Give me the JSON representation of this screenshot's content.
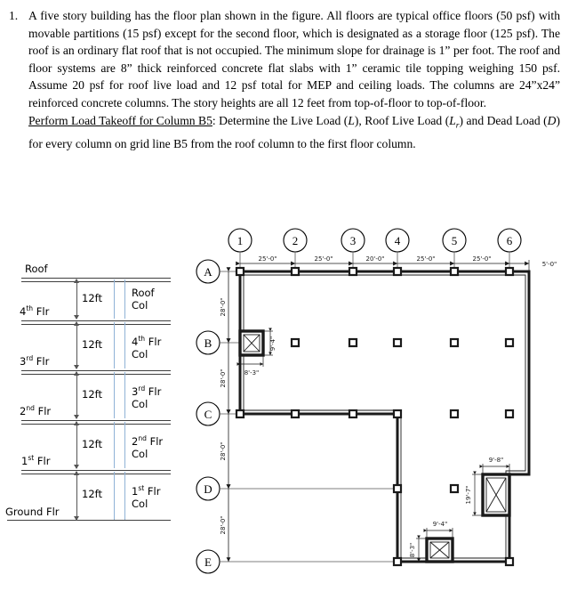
{
  "problem": {
    "number": "1.",
    "paragraphs": [
      "A five story building has the floor plan shown in the figure. All floors are typical office floors (50 psf) with movable partitions (15 psf) except for the second floor, which is designated as a storage floor (125 psf). The roof is an ordinary flat roof that is not occupied. The minimum slope for drainage is 1” per foot. The roof and floor systems are 8” thick reinforced concrete flat slabs with 1” ceramic tile topping weighing 150 psf. Assume 20 psf for roof live load and 12 psf total for MEP and ceiling loads. The columns are 24”x24” reinforced concrete columns. The story heights are all 12 feet from top-of-floor to top-of-floor."
    ],
    "task_label": "Perform Load Takeoff for Column B5",
    "task_text_1": ": Determine the Live Load (",
    "task_var_L": "L",
    "task_text_2": "), Roof Live Load (",
    "task_var_Lr": "L",
    "task_var_Lr_sub": "r",
    "task_text_3": ") and Dead Load (",
    "task_var_D": "D",
    "task_text_4": ") for every column on grid line B5 from the roof column to the first floor column."
  },
  "section_diagram": {
    "levels": [
      {
        "label": "Roof",
        "sup": ""
      },
      {
        "label": " Flr",
        "sup": "th",
        "prefix": "4"
      },
      {
        "label": " Flr",
        "sup": "rd",
        "prefix": "3"
      },
      {
        "label": " Flr",
        "sup": "nd",
        "prefix": "2"
      },
      {
        "label": " Flr",
        "sup": "st",
        "prefix": "1"
      },
      {
        "label": "Ground  Flr",
        "sup": ""
      }
    ],
    "level_labels": [
      "Roof",
      "4th Flr",
      "3rd Flr",
      "2nd Flr",
      "1st Flr",
      "Ground  Flr"
    ],
    "story_height": "12ft",
    "story_heights": [
      "12ft",
      "12ft",
      "12ft",
      "12ft",
      "12ft"
    ],
    "column_labels": [
      {
        "line1": "Roof",
        "line2": "Col"
      },
      {
        "line1": "4th Flr",
        "line2": "Col"
      },
      {
        "line1": "3rd  Flr",
        "line2": "Col"
      },
      {
        "line1": "2nd  Flr",
        "line2": "Col"
      },
      {
        "line1": "1st  Flr",
        "line2": "Col"
      }
    ],
    "column_band_color": "#8fb2d6"
  },
  "floor_plan": {
    "column_grid_labels": [
      "1",
      "2",
      "3",
      "4",
      "5",
      "6"
    ],
    "row_grid_labels": [
      "A",
      "B",
      "C",
      "D",
      "E"
    ],
    "bay_dimensions_horizontal": [
      "25'-0\"",
      "25'-0\"",
      "20'-0\"",
      "25'-0\"",
      "25'-0\""
    ],
    "overhang_right": "5'-0\"",
    "bay_dimensions_vertical": [
      "28'-0\"",
      "28'-0\"",
      "28'-0\"",
      "28'-0\""
    ],
    "shafts": [
      {
        "name": "shaft-b1",
        "width": "8'-3\"",
        "height": "9'-4\""
      },
      {
        "name": "shaft-d6",
        "width": "9'-8\"",
        "height": "19'-7\""
      },
      {
        "name": "shaft-e5",
        "width": "9'-4\"",
        "height": "8'-3\""
      }
    ],
    "column_size_note": "24\"x24\""
  }
}
